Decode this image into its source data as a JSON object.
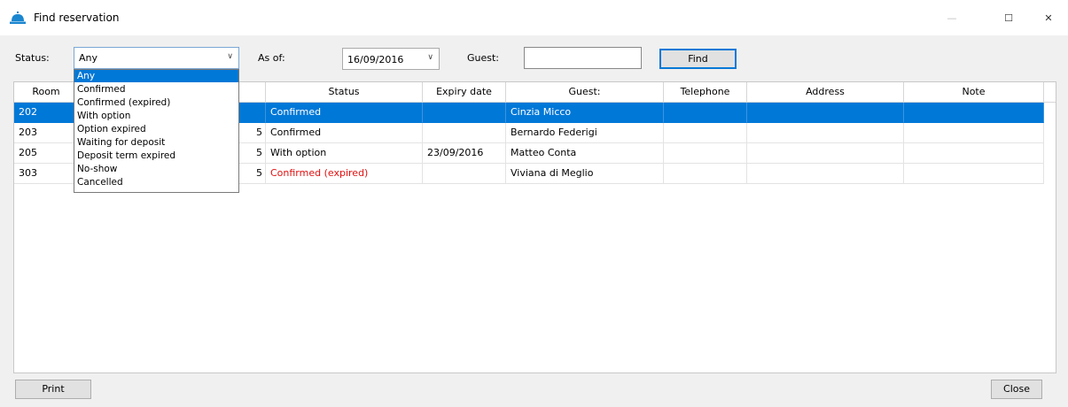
{
  "window": {
    "title": "Find reservation",
    "minimize_glyph": "—",
    "maximize_glyph": "☐",
    "close_glyph": "✕"
  },
  "filters": {
    "status_label": "Status:",
    "status_value": "Any",
    "as_of_label": "As of:",
    "as_of_value": "16/09/2016",
    "guest_label": "Guest:",
    "guest_value": "",
    "find_label": "Find"
  },
  "status_options": [
    "Any",
    "Confirmed",
    "Confirmed (expired)",
    "With option",
    "Option expired",
    "Waiting for deposit",
    "Deposit term expired",
    "No-show",
    "Cancelled"
  ],
  "table": {
    "columns": [
      "Room",
      "",
      "Status",
      "Expiry date",
      "Guest:",
      "Telephone",
      "Address",
      "Note"
    ],
    "rows": [
      {
        "room": "202",
        "hidden": "",
        "status": "Confirmed",
        "expiry": "",
        "guest": "Cinzia Micco",
        "telephone": "",
        "address": "",
        "note": ""
      },
      {
        "room": "203",
        "hidden": "5",
        "status": "Confirmed",
        "expiry": "",
        "guest": "Bernardo Federigi",
        "telephone": "",
        "address": "",
        "note": ""
      },
      {
        "room": "205",
        "hidden": "5",
        "status": "With option",
        "expiry": "23/09/2016",
        "guest": "Matteo Conta",
        "telephone": "",
        "address": "",
        "note": ""
      },
      {
        "room": "303",
        "hidden": "5",
        "status": "Confirmed (expired)",
        "expiry": "",
        "guest": "Viviana di Meglio",
        "telephone": "",
        "address": "",
        "note": ""
      }
    ],
    "selected_row": 0
  },
  "footer": {
    "print_label": "Print",
    "close_label": "Close"
  },
  "colors": {
    "selection": "#0078d7",
    "expired_text": "#e01010",
    "app_icon": "#1a86d0"
  },
  "icons": {
    "app": "bell-icon",
    "dropdown": "chevron-down-icon"
  }
}
